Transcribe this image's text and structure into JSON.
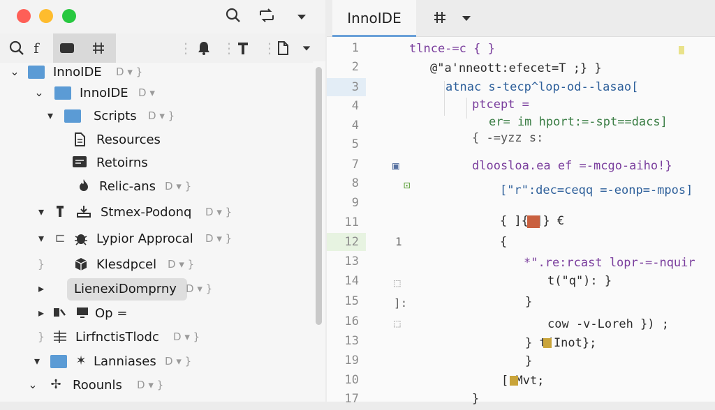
{
  "window": {
    "title": "InnoIDE"
  },
  "toolbar": {
    "icons": [
      "search-icon",
      "flow-icon",
      "chevron-down-icon"
    ],
    "secondary_icons": [
      "search-icon",
      "function-icon",
      "panel-icon",
      "grid-icon",
      "bell-icon",
      "pin-icon",
      "document-icon",
      "chevron-down-icon"
    ],
    "fn_glyph": "f"
  },
  "tree": {
    "items": [
      {
        "label": "InnoIDE",
        "meta": "D ▾ }",
        "chevron": "⌄",
        "icon": "folder"
      },
      {
        "label": "InnoIDE",
        "meta": "D ▾",
        "chevron": "⌄",
        "icon": "folder"
      },
      {
        "label": "Scripts",
        "meta": "D ▾ }",
        "chevron": "▾",
        "icon": "folder"
      },
      {
        "label": "Resources",
        "meta": "",
        "chevron": "",
        "icon": "document"
      },
      {
        "label": "Retoirns",
        "meta": "",
        "chevron": "",
        "icon": "list"
      },
      {
        "label": "Relic-ans",
        "meta": "D ▾ }",
        "chevron": "",
        "icon": "flame"
      },
      {
        "label": "Stmex-Podonq",
        "meta": "D ▾ }",
        "chevron": "▾",
        "icon": "tray"
      },
      {
        "label": "Lypior Approcal",
        "meta": "D ▾ }",
        "chevron": "▾",
        "icon": "bug"
      },
      {
        "label": "Klesdpcel",
        "meta": "D ▾ }",
        "chevron": "}",
        "icon": "cube"
      },
      {
        "label": "LienexiDomprny",
        "meta": "D ▾ }",
        "chevron": "▸",
        "icon": "none"
      },
      {
        "label": "Op =",
        "meta": "",
        "chevron": "▸",
        "icon": "monitor"
      },
      {
        "label": "LirfnctisTlodc",
        "meta": "D ▾ }",
        "chevron": "}",
        "icon": "lines"
      },
      {
        "label": "Lanniases",
        "meta": "D ▾ }",
        "chevron": "▾",
        "icon": "star"
      },
      {
        "label": "Roounls",
        "meta": "D ▾ }",
        "chevron": "⌄",
        "icon": "cross"
      }
    ]
  },
  "editor": {
    "tab_label": "InnoIDE",
    "tab_icons": [
      "grid-icon",
      "chevron-down-icon"
    ],
    "line_numbers": [
      "1",
      "2",
      "3",
      "4",
      "4",
      "5",
      "7",
      "8",
      "9",
      "11",
      "12",
      "13",
      "14",
      "15",
      "16",
      "13",
      "19",
      "10",
      "17"
    ],
    "current_line_index": 2,
    "selected_line_index": 10,
    "gutter_marks": [
      "",
      "",
      "",
      "",
      "",
      "",
      "▣",
      "⊡",
      "",
      "",
      "1",
      "",
      "⬚",
      "]:",
      "⬚",
      "",
      "",
      "",
      ""
    ],
    "code_lines": [
      "tlnce-=c { }",
      "@\"a'nneott:efecet=T ;}          }",
      "atnac s-tecp^lop-od--lasao[",
      "ptcept =",
      "er= im hport:=-spt==dacs]",
      "{ -=yzz  s:",
      "dloosloa.ea ef =-mcgo-aiho!}",
      "[\"r\":dec=ceqq =-eonp=-mpos]",
      "{    ]{v]} €",
      "{",
      "*\".re:rcast lopr-=-nquir",
      "t(\"q\"):  }",
      "}",
      "cow -v-Loreh }) ;",
      "} t(Inot};",
      "}",
      "[-Mvt;",
      "}"
    ]
  },
  "colors": {
    "close": "#fe5f57",
    "minimize": "#febc2e",
    "maximize": "#28c840",
    "folder": "#5b9bd5",
    "accent": "#6aa0d8"
  }
}
